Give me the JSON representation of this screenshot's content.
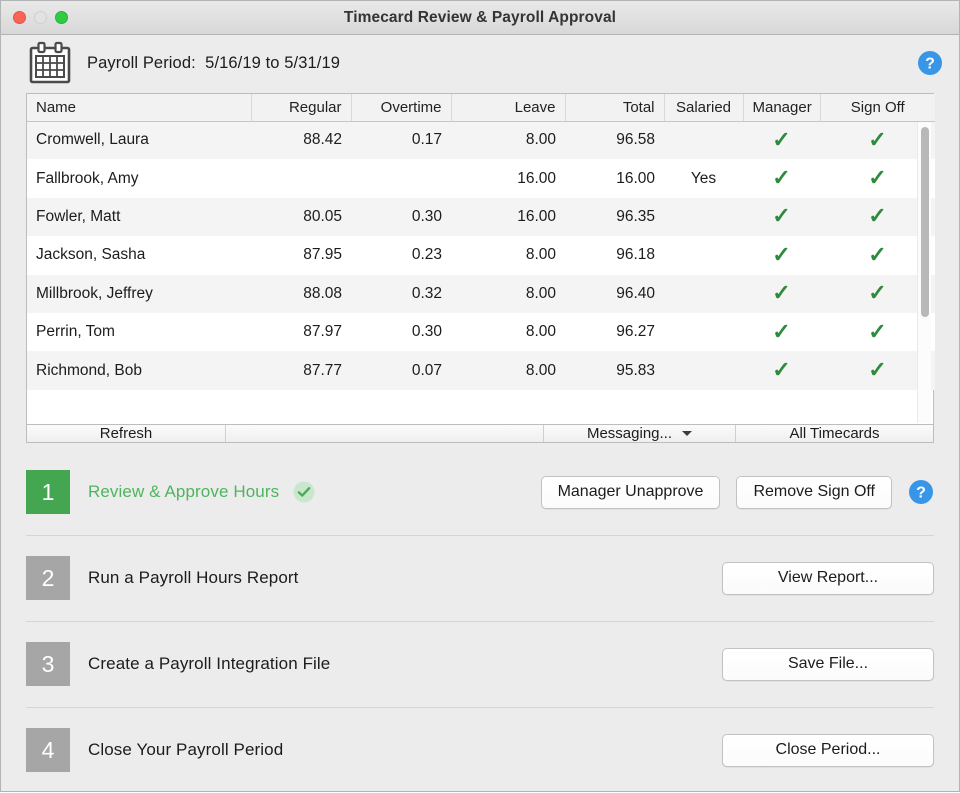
{
  "window": {
    "title": "Timecard Review & Payroll Approval",
    "traffic_lights": [
      "close-button",
      "minimize-button",
      "maximize-button"
    ]
  },
  "period": {
    "icon": "calendar-icon",
    "label": "Payroll Period:  5/16/19 to 5/31/19",
    "help_icon": "help-icon"
  },
  "table": {
    "columns": [
      "Name",
      "Regular",
      "Overtime",
      "Leave",
      "Total",
      "Salaried",
      "Manager",
      "Sign Off"
    ],
    "check_glyph": "✓",
    "check_color": "#2e8b3d",
    "rows": [
      {
        "name": "Cromwell, Laura",
        "regular": "88.42",
        "overtime": "0.17",
        "leave": "8.00",
        "total": "96.58",
        "salaried": "",
        "manager": "✓",
        "signoff": "✓"
      },
      {
        "name": "Fallbrook, Amy",
        "regular": "",
        "overtime": "",
        "leave": "16.00",
        "total": "16.00",
        "salaried": "Yes",
        "manager": "✓",
        "signoff": "✓"
      },
      {
        "name": "Fowler, Matt",
        "regular": "80.05",
        "overtime": "0.30",
        "leave": "16.00",
        "total": "96.35",
        "salaried": "",
        "manager": "✓",
        "signoff": "✓"
      },
      {
        "name": "Jackson, Sasha",
        "regular": "87.95",
        "overtime": "0.23",
        "leave": "8.00",
        "total": "96.18",
        "salaried": "",
        "manager": "✓",
        "signoff": "✓"
      },
      {
        "name": "Millbrook, Jeffrey",
        "regular": "88.08",
        "overtime": "0.32",
        "leave": "8.00",
        "total": "96.40",
        "salaried": "",
        "manager": "✓",
        "signoff": "✓"
      },
      {
        "name": "Perrin, Tom",
        "regular": "87.97",
        "overtime": "0.30",
        "leave": "8.00",
        "total": "96.27",
        "salaried": "",
        "manager": "✓",
        "signoff": "✓"
      },
      {
        "name": "Richmond, Bob",
        "regular": "87.77",
        "overtime": "0.07",
        "leave": "8.00",
        "total": "95.83",
        "salaried": "",
        "manager": "✓",
        "signoff": "✓"
      }
    ]
  },
  "table_footer": {
    "refresh_label": "Refresh",
    "messaging_label": "Messaging...",
    "all_timecards_label": "All Timecards"
  },
  "steps": [
    {
      "number": "1",
      "title": "Review & Approve Hours",
      "state": "complete",
      "has_check": true,
      "has_help": true,
      "buttons": [
        "Manager Unapprove",
        "Remove Sign Off"
      ]
    },
    {
      "number": "2",
      "title": "Run a Payroll Hours Report",
      "state": "idle",
      "has_check": false,
      "has_help": false,
      "buttons": [
        "View Report..."
      ]
    },
    {
      "number": "3",
      "title": "Create a Payroll Integration File",
      "state": "idle",
      "has_check": false,
      "has_help": false,
      "buttons": [
        "Save File..."
      ]
    },
    {
      "number": "4",
      "title": "Close Your Payroll Period",
      "state": "idle",
      "has_check": false,
      "has_help": false,
      "buttons": [
        "Close Period..."
      ]
    }
  ],
  "colors": {
    "accent_green": "#44a651",
    "title_green": "#4fb45f",
    "badge_gray": "#a6a6a6",
    "help_blue": "#3896e8",
    "check_green": "#2e8b3d",
    "window_bg": "#ececec"
  }
}
